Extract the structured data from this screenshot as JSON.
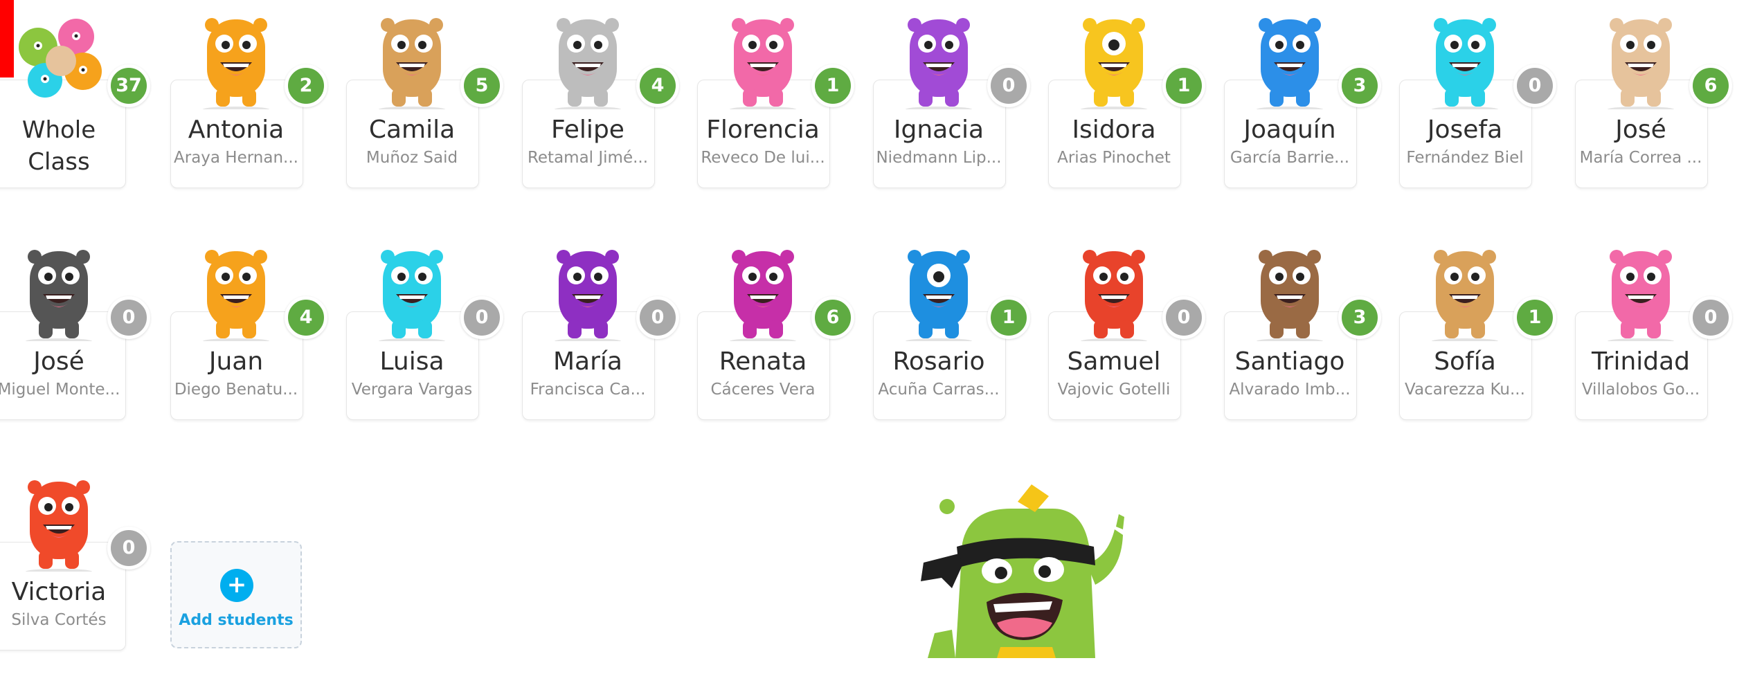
{
  "students": [
    {
      "first": "Whole",
      "last": "Class",
      "points": "37",
      "status": "green",
      "monster": "group",
      "color": "#5fab42"
    },
    {
      "first": "Antonia",
      "last": "Araya Hernan...",
      "points": "2",
      "status": "green",
      "monster": "orange-bear",
      "color": "#f6a21c"
    },
    {
      "first": "Camila",
      "last": "Muñoz Said",
      "points": "5",
      "status": "green",
      "monster": "calico",
      "color": "#d9a15a"
    },
    {
      "first": "Felipe",
      "last": "Retamal Jimé...",
      "points": "4",
      "status": "green",
      "monster": "gray-cow",
      "color": "#bdbdbd"
    },
    {
      "first": "Florencia",
      "last": "Reveco De lui...",
      "points": "1",
      "status": "green",
      "monster": "pink-fuzzy",
      "color": "#f269a8"
    },
    {
      "first": "Ignacia",
      "last": "Niedmann Lip...",
      "points": "0",
      "status": "gray",
      "monster": "purple-bird",
      "color": "#a14bd6"
    },
    {
      "first": "Isidora",
      "last": "Arias Pinochet",
      "points": "1",
      "status": "green",
      "monster": "yellow-cyclops",
      "color": "#f7c51f"
    },
    {
      "first": "Joaquín",
      "last": "García Barrie...",
      "points": "3",
      "status": "green",
      "monster": "blue-tall",
      "color": "#2c8fe8"
    },
    {
      "first": "Josefa",
      "last": "Fernández Biel",
      "points": "0",
      "status": "gray",
      "monster": "cyan-fuzzy",
      "color": "#2bd1e8"
    },
    {
      "first": "José",
      "last": "María Correa ...",
      "points": "6",
      "status": "green",
      "monster": "tan-hair",
      "color": "#e6c39c"
    },
    {
      "first": "José",
      "last": "Miguel Monte...",
      "points": "0",
      "status": "gray",
      "monster": "black-shark",
      "color": "#555555"
    },
    {
      "first": "Juan",
      "last": "Diego Benatu...",
      "points": "4",
      "status": "green",
      "monster": "orange-bear",
      "color": "#f6a21c"
    },
    {
      "first": "Luisa",
      "last": "Vergara Vargas",
      "points": "0",
      "status": "gray",
      "monster": "cyan-fuzzy",
      "color": "#2bd1e8"
    },
    {
      "first": "María",
      "last": "Francisca Ca...",
      "points": "0",
      "status": "gray",
      "monster": "purple-drip",
      "color": "#8e2fc2"
    },
    {
      "first": "Renata",
      "last": "Cáceres Vera",
      "points": "6",
      "status": "green",
      "monster": "magenta-squid",
      "color": "#c62fa8"
    },
    {
      "first": "Rosario",
      "last": "Acuña Carras...",
      "points": "1",
      "status": "green",
      "monster": "blue-cyclops",
      "color": "#1e8fe0"
    },
    {
      "first": "Samuel",
      "last": "Vajovic Gotelli",
      "points": "0",
      "status": "gray",
      "monster": "red-hair",
      "color": "#e8432b"
    },
    {
      "first": "Santiago",
      "last": "Alvarado Imb...",
      "points": "3",
      "status": "green",
      "monster": "brown-target",
      "color": "#9a6a44"
    },
    {
      "first": "Sofía",
      "last": "Vacarezza Ku...",
      "points": "1",
      "status": "green",
      "monster": "calico",
      "color": "#d9a15a"
    },
    {
      "first": "Trinidad",
      "last": "Villalobos Go...",
      "points": "0",
      "status": "gray",
      "monster": "pink-fuzzy",
      "color": "#f269a8"
    },
    {
      "first": "Victoria",
      "last": "Silva Cortés",
      "points": "0",
      "status": "gray",
      "monster": "red-antler",
      "color": "#f04a2a"
    }
  ],
  "add_students": {
    "label": "Add students",
    "icon": "plus-icon",
    "color": "#00aeef"
  },
  "mascot": {
    "name": "ninja-monster",
    "color": "#8cc63f"
  },
  "colors": {
    "green_badge": "#5fab42",
    "gray_badge": "#a9a9a9"
  }
}
